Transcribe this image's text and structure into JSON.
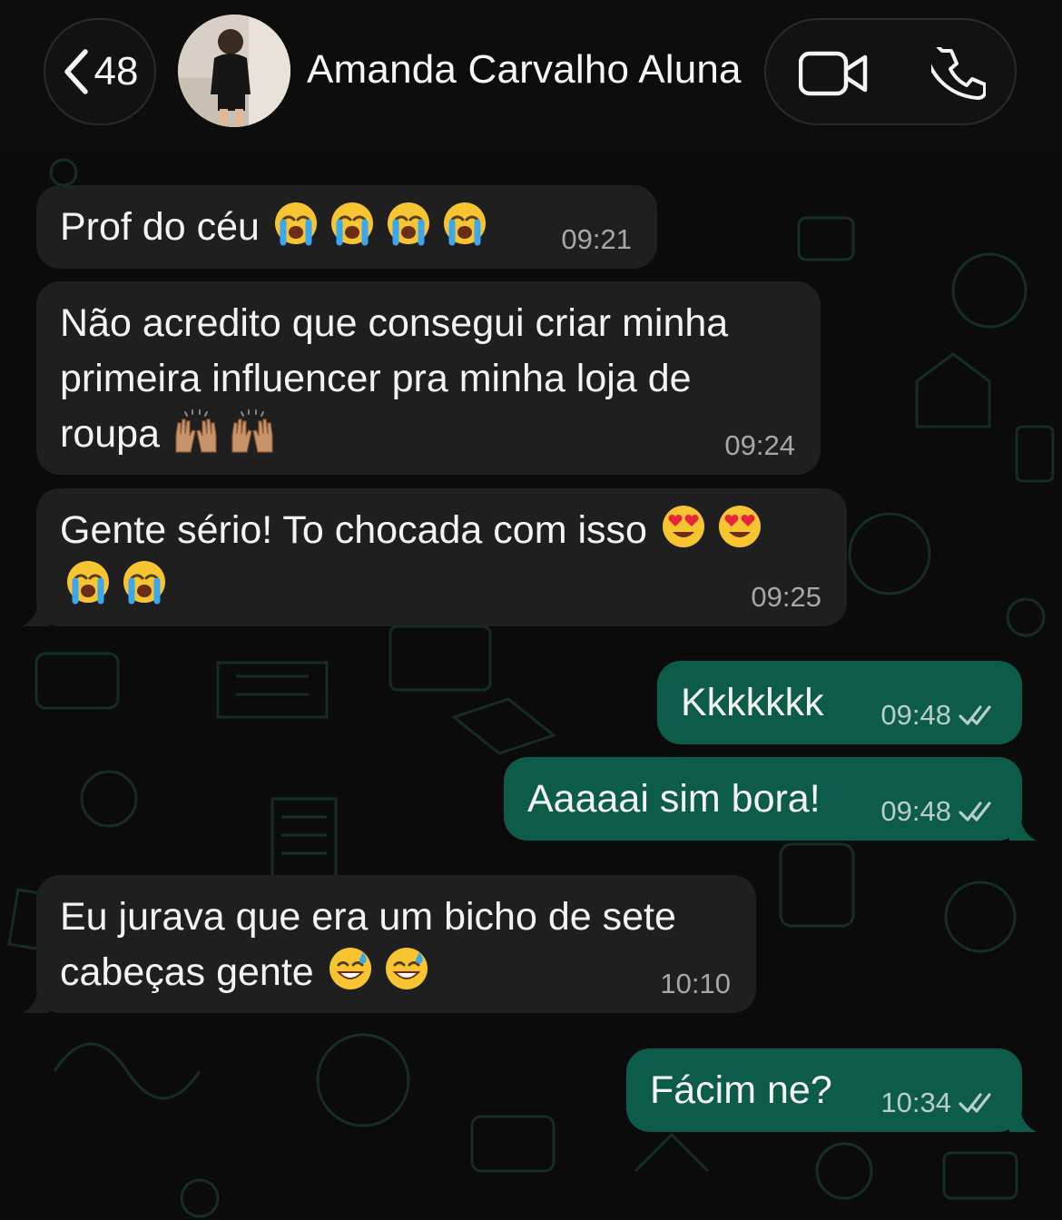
{
  "header": {
    "back_count": "48",
    "contact_name": "Amanda Carvalho Aluna"
  },
  "messages": [
    {
      "direction": "in",
      "text": "Prof do céu",
      "emoji_after": [
        "loudly-crying-face",
        "loudly-crying-face",
        "loudly-crying-face",
        "loudly-crying-face"
      ],
      "time": "09:21"
    },
    {
      "direction": "in",
      "text": "Não acredito que consegui criar minha\nprimeira influencer pra minha loja de\nroupa",
      "emoji_after": [
        "raising-hands",
        "raising-hands"
      ],
      "time": "09:24"
    },
    {
      "direction": "in",
      "text": "Gente sério! To chocada com isso",
      "emoji_after": [
        "heart-eyes-face",
        "heart-eyes-face",
        "loudly-crying-face",
        "loudly-crying-face"
      ],
      "time": "09:25"
    },
    {
      "direction": "out",
      "text": "Kkkkkkk",
      "time": "09:48",
      "status": "read"
    },
    {
      "direction": "out",
      "text": "Aaaaai sim bora!",
      "time": "09:48",
      "status": "read"
    },
    {
      "direction": "in",
      "text": "Eu jurava que era um bicho de sete\ncabeças gente",
      "emoji_after": [
        "grinning-sweat-face",
        "grinning-sweat-face"
      ],
      "time": "10:10"
    },
    {
      "direction": "out",
      "text": "Fácim ne?",
      "time": "10:34",
      "status": "read"
    }
  ],
  "colors": {
    "background": "#0b0b0b",
    "incoming_bubble": "#1f1f1f",
    "outgoing_bubble": "#0d5c4a",
    "timestamp": "#a7a7a7"
  }
}
